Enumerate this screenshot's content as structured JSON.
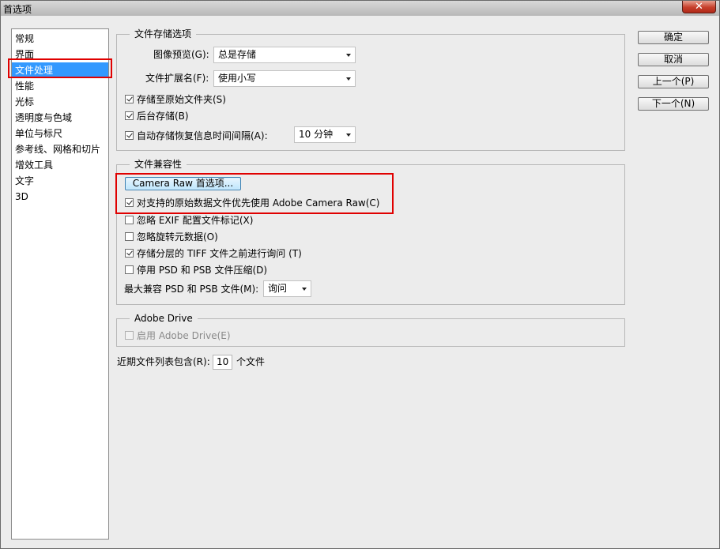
{
  "window": {
    "title": "首选项",
    "close_glyph": "✕"
  },
  "sidebar": {
    "items": [
      {
        "label": "常规"
      },
      {
        "label": "界面"
      },
      {
        "label": "文件处理"
      },
      {
        "label": "性能"
      },
      {
        "label": "光标"
      },
      {
        "label": "透明度与色域"
      },
      {
        "label": "单位与标尺"
      },
      {
        "label": "参考线、网格和切片"
      },
      {
        "label": "增效工具"
      },
      {
        "label": "文字"
      },
      {
        "label": "3D"
      }
    ],
    "selected_index": 2
  },
  "file_saving": {
    "legend": "文件存储选项",
    "image_preview_label": "图像预览(G):",
    "image_preview_value": "总是存储",
    "file_extension_label": "文件扩展名(F):",
    "file_extension_value": "使用小写",
    "save_to_original_folder": {
      "label": "存储至原始文件夹(S)",
      "checked": true
    },
    "background_save": {
      "label": "后台存储(B)",
      "checked": true
    },
    "autosave": {
      "label": "自动存储恢复信息时间间隔(A):",
      "checked": true
    },
    "autosave_interval_value": "10 分钟"
  },
  "compatibility": {
    "legend": "文件兼容性",
    "camera_raw_button": "Camera Raw 首选项...",
    "prefer_acr": {
      "label": "对支持的原始数据文件优先使用 Adobe Camera Raw(C)",
      "checked": true
    },
    "ignore_exif": {
      "label": "忽略 EXIF 配置文件标记(X)",
      "checked": false
    },
    "ignore_rotation": {
      "label": "忽略旋转元数据(O)",
      "checked": false
    },
    "ask_layered_tiff": {
      "label": "存储分层的 TIFF 文件之前进行询问 (T)",
      "checked": true
    },
    "disable_compression": {
      "label": "停用 PSD 和 PSB 文件压缩(D)",
      "checked": false
    },
    "max_compat_label": "最大兼容 PSD 和 PSB 文件(M):",
    "max_compat_value": "询问"
  },
  "adobe_drive": {
    "legend": "Adobe Drive",
    "enable": {
      "label": "启用 Adobe Drive(E)",
      "checked": false
    }
  },
  "recent_files": {
    "label": "近期文件列表包含(R):",
    "value": "10",
    "suffix": "个文件"
  },
  "buttons": {
    "ok": "确定",
    "cancel": "取消",
    "prev": "上一个(P)",
    "next": "下一个(N)"
  }
}
